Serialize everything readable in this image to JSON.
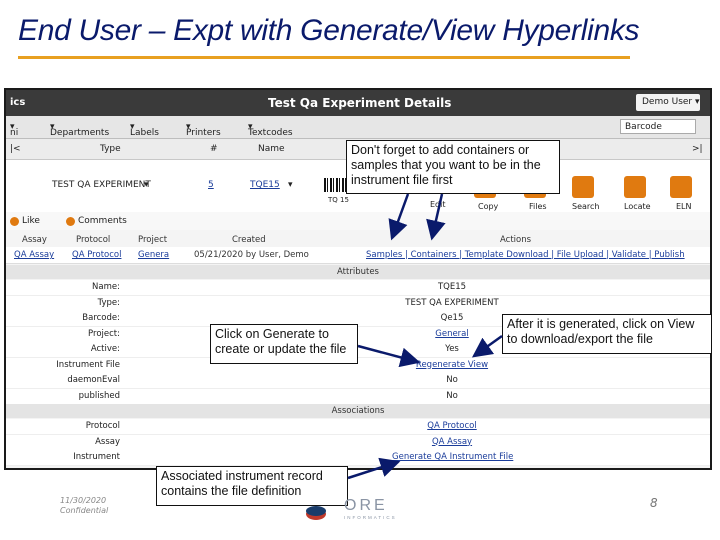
{
  "slide": {
    "title": "End User – Expt with Generate/View Hyperlinks",
    "date": "11/30/2020",
    "confidential": "Confidential",
    "page_number": "8",
    "logo_text": "ORE",
    "logo_sub": "INFORMATICS",
    "accent_color": "#e8a020",
    "title_color": "#0a1a6b"
  },
  "app": {
    "brand": "ics",
    "page_title": "Test Qa Experiment Details",
    "user_menu": "Demo User",
    "menu": [
      "Departments",
      "Labels",
      "Printers",
      "Textcodes"
    ],
    "menu_first": "ni",
    "barcode_placeholder": "Barcode",
    "columns": {
      "type": "Type",
      "num": "#",
      "name": "Name",
      "end": ">|"
    },
    "row": {
      "type": "TEST QA EXPERIMENT",
      "num": "5",
      "name": "TQE15",
      "barcode_text": "TQ 15"
    },
    "tools": [
      "Copy",
      "Files",
      "Search",
      "Locate",
      "ELN"
    ],
    "tool_edit": "Edit",
    "like_label": "Like",
    "comment_label": "Comments",
    "info_headers": {
      "assay": "Assay",
      "protocol": "Protocol",
      "project": "Project",
      "created": "Created",
      "actions": "Actions"
    },
    "info_values": {
      "assay": "QA Assay",
      "protocol": "QA Protocol",
      "project": "Genera",
      "created": "05/21/2020 by User, Demo",
      "actions": "Samples | Containers | Template Download | File Upload | Validate | Publish"
    },
    "attributes_header": "Attributes",
    "attributes": [
      {
        "label": "Name:",
        "value": "TQE15",
        "link": false
      },
      {
        "label": "Type:",
        "value": "TEST QA EXPERIMENT",
        "link": false
      },
      {
        "label": "Barcode:",
        "value": "Qe15",
        "link": false
      },
      {
        "label": "Project:",
        "value": "General",
        "link": true
      },
      {
        "label": "Active:",
        "value": "Yes",
        "link": false
      },
      {
        "label": "Instrument File",
        "value": "Regenerate View",
        "link": true
      },
      {
        "label": "daemonEval",
        "value": "No",
        "link": false
      },
      {
        "label": "published",
        "value": "No",
        "link": false
      }
    ],
    "associations_header": "Associations",
    "associations": [
      {
        "label": "Protocol",
        "value": "QA Protocol",
        "link": true
      },
      {
        "label": "Assay",
        "value": "QA Assay",
        "link": true
      },
      {
        "label": "Instrument",
        "value": "Generate QA Instrument File",
        "link": true
      }
    ]
  },
  "callouts": {
    "containers": "Don't forget to add containers or samples that you want to be in the instrument file first",
    "generate": "Click on Generate to create or update the file",
    "view": "After it is generated, click on View to download/export the file",
    "record": "Associated instrument record contains the file definition"
  }
}
